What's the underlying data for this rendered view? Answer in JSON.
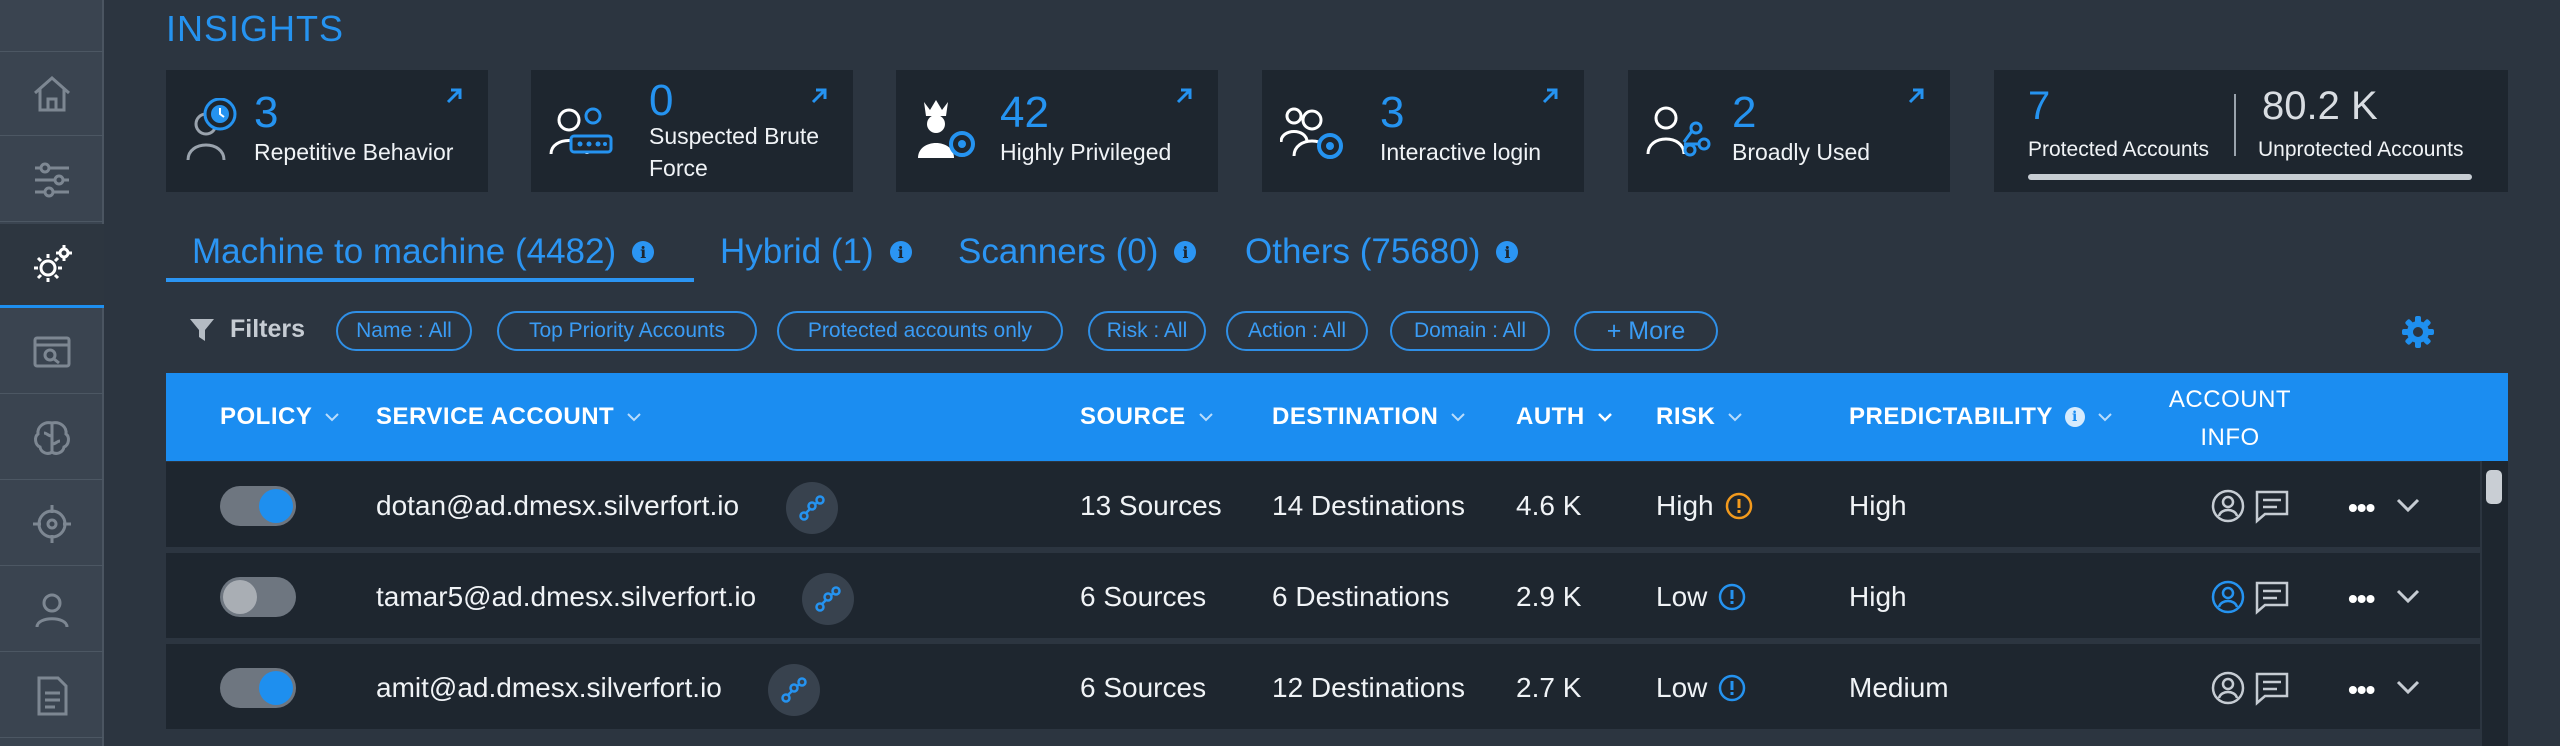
{
  "insights": {
    "title": "INSIGHTS",
    "cards": [
      {
        "value": "3",
        "label": "Repetitive Behavior"
      },
      {
        "value": "0",
        "label": "Suspected Brute Force"
      },
      {
        "value": "42",
        "label": "Highly Privileged"
      },
      {
        "value": "3",
        "label": "Interactive login"
      },
      {
        "value": "2",
        "label": "Broadly Used"
      }
    ],
    "protection": {
      "protected_value": "7",
      "protected_label": "Protected Accounts",
      "unprotected_value": "80.2 K",
      "unprotected_label": "Unprotected Accounts"
    }
  },
  "tabs": [
    {
      "label": "Machine to machine (4482)"
    },
    {
      "label": "Hybrid (1)"
    },
    {
      "label": "Scanners (0)"
    },
    {
      "label": "Others (75680)"
    }
  ],
  "filters": {
    "label": "Filters",
    "chips": [
      "Name : All",
      "Top Priority Accounts",
      "Protected accounts only",
      "Risk : All",
      "Action : All",
      "Domain : All",
      "+ More"
    ]
  },
  "table": {
    "headers": {
      "policy": "POLICY",
      "service_account": "SERVICE ACCOUNT",
      "source": "SOURCE",
      "destination": "DESTINATION",
      "auth": "AUTH",
      "risk": "RISK",
      "predictability": "PREDICTABILITY",
      "account_info_1": "ACCOUNT",
      "account_info_2": "INFO"
    },
    "rows": [
      {
        "policy_on": true,
        "account": "dotan@ad.dmesx.silverfort.io",
        "source": "13 Sources",
        "destination": "14 Destinations",
        "auth": "4.6 K",
        "risk": "High",
        "predictability": "High"
      },
      {
        "policy_on": false,
        "account": "tamar5@ad.dmesx.silverfort.io",
        "source": "6 Sources",
        "destination": "6 Destinations",
        "auth": "2.9 K",
        "risk": "Low",
        "predictability": "High"
      },
      {
        "policy_on": true,
        "account": "amit@ad.dmesx.silverfort.io",
        "source": "6 Sources",
        "destination": "12 Destinations",
        "auth": "2.7 K",
        "risk": "Low",
        "predictability": "Medium"
      }
    ]
  },
  "colors": {
    "accent": "#2593f0",
    "risk_high": "#f39a1d",
    "risk_low": "#2593f0"
  }
}
